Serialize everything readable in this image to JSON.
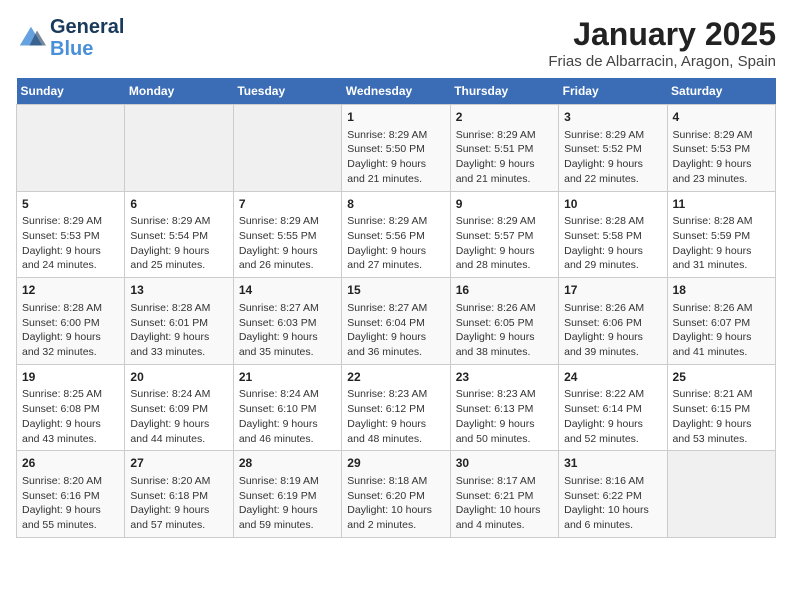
{
  "header": {
    "logo_general": "General",
    "logo_blue": "Blue",
    "title": "January 2025",
    "subtitle": "Frias de Albarracin, Aragon, Spain"
  },
  "days_of_week": [
    "Sunday",
    "Monday",
    "Tuesday",
    "Wednesday",
    "Thursday",
    "Friday",
    "Saturday"
  ],
  "weeks": [
    [
      {
        "day": "",
        "empty": true
      },
      {
        "day": "",
        "empty": true
      },
      {
        "day": "",
        "empty": true
      },
      {
        "day": "1",
        "sunrise": "8:29 AM",
        "sunset": "5:50 PM",
        "daylight": "9 hours and 21 minutes."
      },
      {
        "day": "2",
        "sunrise": "8:29 AM",
        "sunset": "5:51 PM",
        "daylight": "9 hours and 21 minutes."
      },
      {
        "day": "3",
        "sunrise": "8:29 AM",
        "sunset": "5:52 PM",
        "daylight": "9 hours and 22 minutes."
      },
      {
        "day": "4",
        "sunrise": "8:29 AM",
        "sunset": "5:53 PM",
        "daylight": "9 hours and 23 minutes."
      }
    ],
    [
      {
        "day": "5",
        "sunrise": "8:29 AM",
        "sunset": "5:53 PM",
        "daylight": "9 hours and 24 minutes."
      },
      {
        "day": "6",
        "sunrise": "8:29 AM",
        "sunset": "5:54 PM",
        "daylight": "9 hours and 25 minutes."
      },
      {
        "day": "7",
        "sunrise": "8:29 AM",
        "sunset": "5:55 PM",
        "daylight": "9 hours and 26 minutes."
      },
      {
        "day": "8",
        "sunrise": "8:29 AM",
        "sunset": "5:56 PM",
        "daylight": "9 hours and 27 minutes."
      },
      {
        "day": "9",
        "sunrise": "8:29 AM",
        "sunset": "5:57 PM",
        "daylight": "9 hours and 28 minutes."
      },
      {
        "day": "10",
        "sunrise": "8:28 AM",
        "sunset": "5:58 PM",
        "daylight": "9 hours and 29 minutes."
      },
      {
        "day": "11",
        "sunrise": "8:28 AM",
        "sunset": "5:59 PM",
        "daylight": "9 hours and 31 minutes."
      }
    ],
    [
      {
        "day": "12",
        "sunrise": "8:28 AM",
        "sunset": "6:00 PM",
        "daylight": "9 hours and 32 minutes."
      },
      {
        "day": "13",
        "sunrise": "8:28 AM",
        "sunset": "6:01 PM",
        "daylight": "9 hours and 33 minutes."
      },
      {
        "day": "14",
        "sunrise": "8:27 AM",
        "sunset": "6:03 PM",
        "daylight": "9 hours and 35 minutes."
      },
      {
        "day": "15",
        "sunrise": "8:27 AM",
        "sunset": "6:04 PM",
        "daylight": "9 hours and 36 minutes."
      },
      {
        "day": "16",
        "sunrise": "8:26 AM",
        "sunset": "6:05 PM",
        "daylight": "9 hours and 38 minutes."
      },
      {
        "day": "17",
        "sunrise": "8:26 AM",
        "sunset": "6:06 PM",
        "daylight": "9 hours and 39 minutes."
      },
      {
        "day": "18",
        "sunrise": "8:26 AM",
        "sunset": "6:07 PM",
        "daylight": "9 hours and 41 minutes."
      }
    ],
    [
      {
        "day": "19",
        "sunrise": "8:25 AM",
        "sunset": "6:08 PM",
        "daylight": "9 hours and 43 minutes."
      },
      {
        "day": "20",
        "sunrise": "8:24 AM",
        "sunset": "6:09 PM",
        "daylight": "9 hours and 44 minutes."
      },
      {
        "day": "21",
        "sunrise": "8:24 AM",
        "sunset": "6:10 PM",
        "daylight": "9 hours and 46 minutes."
      },
      {
        "day": "22",
        "sunrise": "8:23 AM",
        "sunset": "6:12 PM",
        "daylight": "9 hours and 48 minutes."
      },
      {
        "day": "23",
        "sunrise": "8:23 AM",
        "sunset": "6:13 PM",
        "daylight": "9 hours and 50 minutes."
      },
      {
        "day": "24",
        "sunrise": "8:22 AM",
        "sunset": "6:14 PM",
        "daylight": "9 hours and 52 minutes."
      },
      {
        "day": "25",
        "sunrise": "8:21 AM",
        "sunset": "6:15 PM",
        "daylight": "9 hours and 53 minutes."
      }
    ],
    [
      {
        "day": "26",
        "sunrise": "8:20 AM",
        "sunset": "6:16 PM",
        "daylight": "9 hours and 55 minutes."
      },
      {
        "day": "27",
        "sunrise": "8:20 AM",
        "sunset": "6:18 PM",
        "daylight": "9 hours and 57 minutes."
      },
      {
        "day": "28",
        "sunrise": "8:19 AM",
        "sunset": "6:19 PM",
        "daylight": "9 hours and 59 minutes."
      },
      {
        "day": "29",
        "sunrise": "8:18 AM",
        "sunset": "6:20 PM",
        "daylight": "10 hours and 2 minutes."
      },
      {
        "day": "30",
        "sunrise": "8:17 AM",
        "sunset": "6:21 PM",
        "daylight": "10 hours and 4 minutes."
      },
      {
        "day": "31",
        "sunrise": "8:16 AM",
        "sunset": "6:22 PM",
        "daylight": "10 hours and 6 minutes."
      },
      {
        "day": "",
        "empty": true
      }
    ]
  ]
}
